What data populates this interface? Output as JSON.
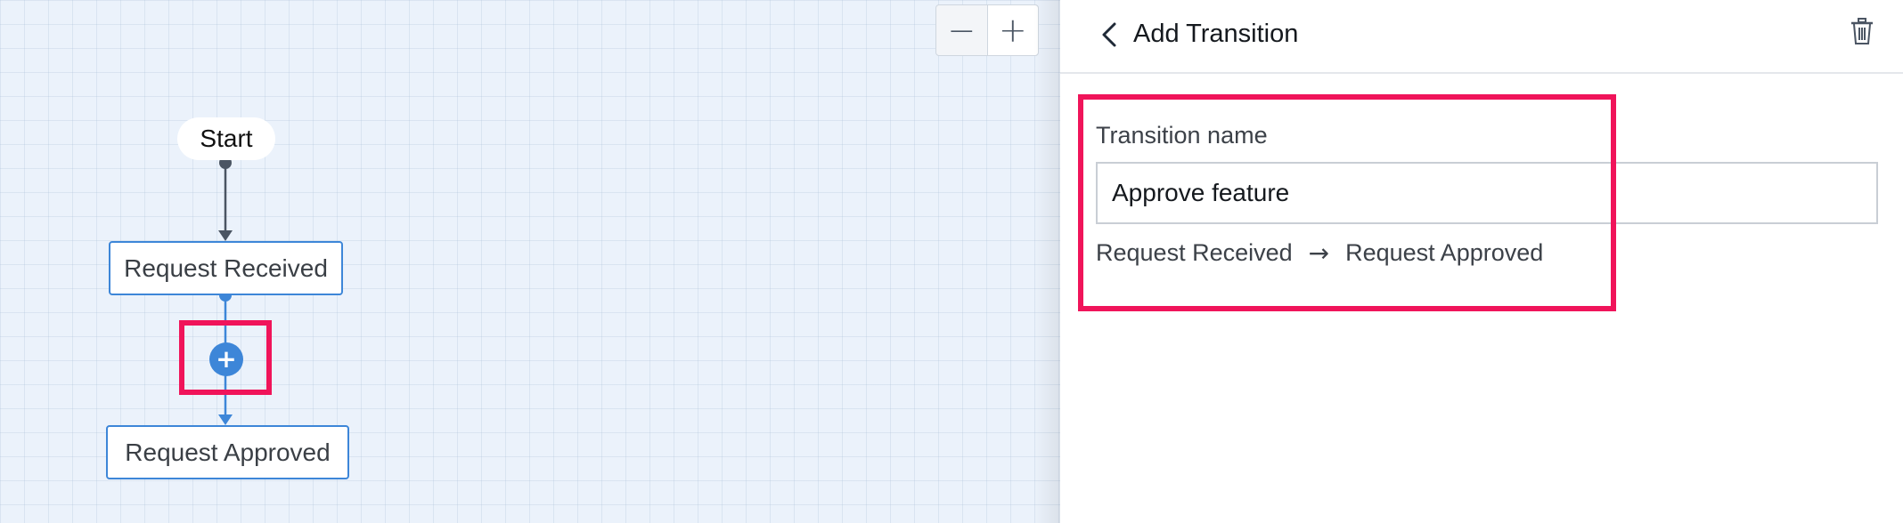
{
  "canvas": {
    "zoom_out_label": "−",
    "zoom_in_label": "+",
    "start_label": "Start",
    "nodes": {
      "received": "Request Received",
      "approved": "Request Approved"
    },
    "add_transition_glyph": "+",
    "colors": {
      "flow_blue": "#3d86d8",
      "highlight": "#f0145a",
      "canvas_bg": "#ebf2fb"
    }
  },
  "panel": {
    "title": "Add Transition",
    "back_icon": "chevron-left-icon",
    "delete_icon": "trash-icon",
    "field_label": "Transition name",
    "field_value": "Approve feature",
    "path_from": "Request Received",
    "path_arrow": "→",
    "path_to": "Request Approved"
  }
}
